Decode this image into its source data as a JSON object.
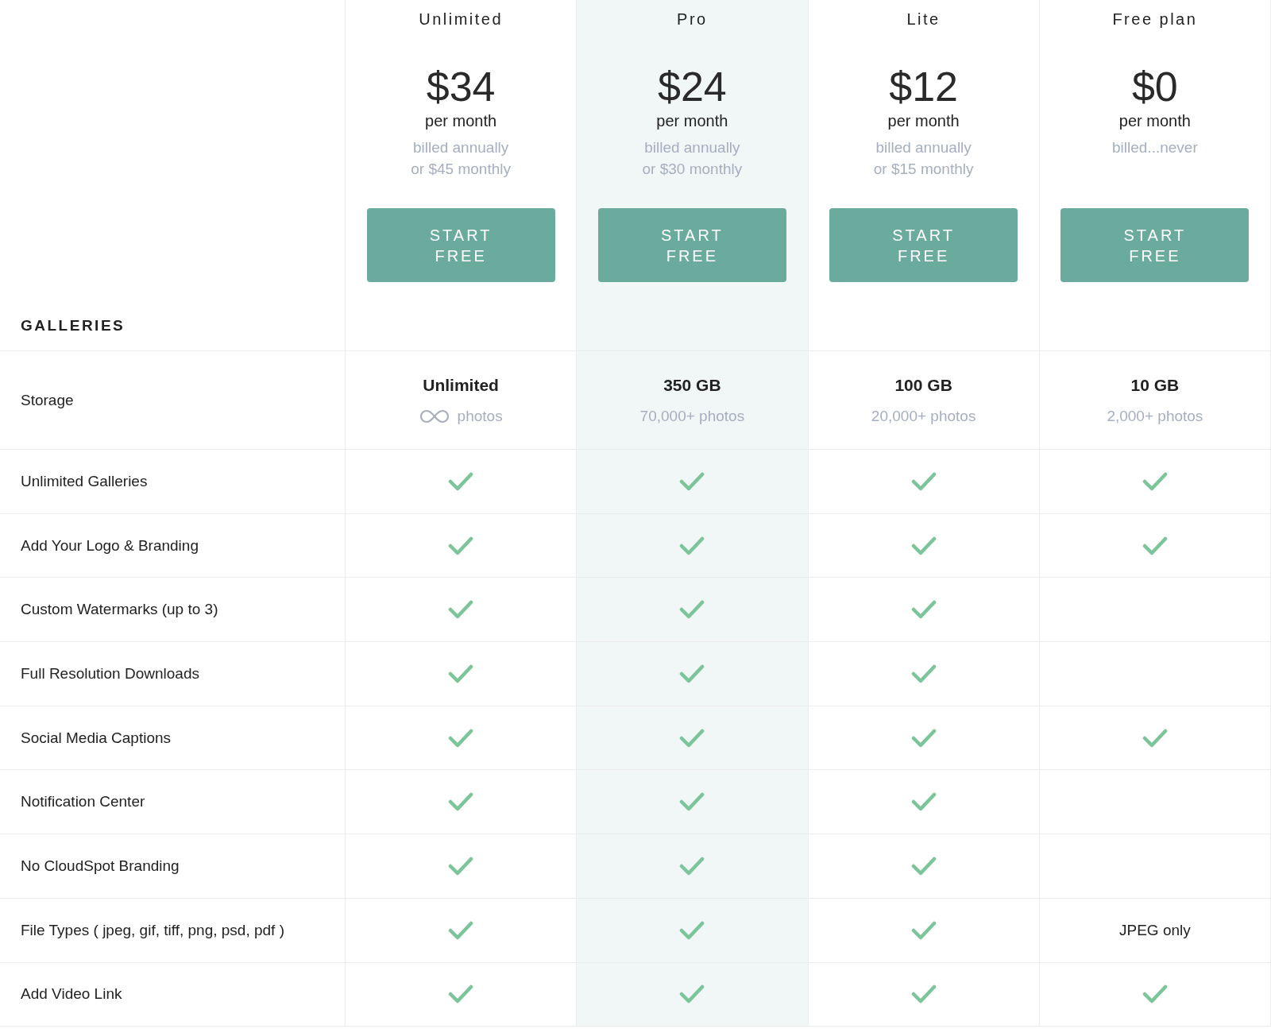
{
  "section_heading": "GALLERIES",
  "plans": [
    {
      "name": "Unlimited",
      "price": "$34",
      "period": "per month",
      "billing": [
        "billed annually",
        "or $45 monthly"
      ],
      "button": "START\nFREE",
      "highlighted": false
    },
    {
      "name": "Pro",
      "price": "$24",
      "period": "per month",
      "billing": [
        "billed annually",
        "or $30 monthly"
      ],
      "button": "START\nFREE",
      "highlighted": true
    },
    {
      "name": "Lite",
      "price": "$12",
      "period": "per month",
      "billing": [
        "billed annually",
        "or $15 monthly"
      ],
      "button": "START\nFREE",
      "highlighted": false
    },
    {
      "name": "Free plan",
      "price": "$0",
      "period": "per month",
      "billing": [
        "billed...never"
      ],
      "button": "START\nFREE",
      "highlighted": false
    }
  ],
  "storage": {
    "label": "Storage",
    "cells": [
      {
        "amount": "Unlimited",
        "photos": "photos",
        "infinite": true
      },
      {
        "amount": "350 GB",
        "photos": "70,000+ photos",
        "infinite": false
      },
      {
        "amount": "100 GB",
        "photos": "20,000+ photos",
        "infinite": false
      },
      {
        "amount": "10 GB",
        "photos": "2,000+ photos",
        "infinite": false
      }
    ]
  },
  "features": [
    {
      "label": "Unlimited Galleries",
      "cells": [
        {
          "kind": "check"
        },
        {
          "kind": "check"
        },
        {
          "kind": "check"
        },
        {
          "kind": "check"
        }
      ]
    },
    {
      "label": "Add Your Logo & Branding",
      "cells": [
        {
          "kind": "check"
        },
        {
          "kind": "check"
        },
        {
          "kind": "check"
        },
        {
          "kind": "check"
        }
      ]
    },
    {
      "label": "Custom Watermarks (up to 3)",
      "cells": [
        {
          "kind": "check"
        },
        {
          "kind": "check"
        },
        {
          "kind": "check"
        },
        {
          "kind": "none"
        }
      ]
    },
    {
      "label": "Full Resolution Downloads",
      "cells": [
        {
          "kind": "check"
        },
        {
          "kind": "check"
        },
        {
          "kind": "check"
        },
        {
          "kind": "none"
        }
      ]
    },
    {
      "label": "Social Media Captions",
      "cells": [
        {
          "kind": "check"
        },
        {
          "kind": "check"
        },
        {
          "kind": "check"
        },
        {
          "kind": "check"
        }
      ]
    },
    {
      "label": "Notification Center",
      "cells": [
        {
          "kind": "check"
        },
        {
          "kind": "check"
        },
        {
          "kind": "check"
        },
        {
          "kind": "none"
        }
      ]
    },
    {
      "label": "No CloudSpot Branding",
      "cells": [
        {
          "kind": "check"
        },
        {
          "kind": "check"
        },
        {
          "kind": "check"
        },
        {
          "kind": "none"
        }
      ]
    },
    {
      "label": "File Types ( jpeg, gif, tiff, png, psd, pdf )",
      "cells": [
        {
          "kind": "check"
        },
        {
          "kind": "check"
        },
        {
          "kind": "check"
        },
        {
          "kind": "text",
          "text": "JPEG only"
        }
      ]
    },
    {
      "label": "Add Video Link",
      "cells": [
        {
          "kind": "check"
        },
        {
          "kind": "check"
        },
        {
          "kind": "check"
        },
        {
          "kind": "check"
        }
      ]
    }
  ]
}
